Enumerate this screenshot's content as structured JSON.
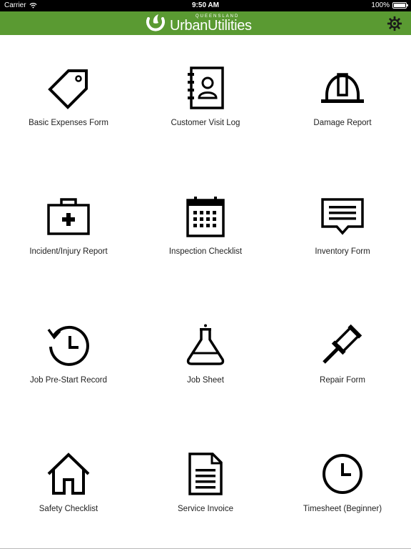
{
  "status_bar": {
    "carrier": "Carrier",
    "time": "9:50 AM",
    "battery": "100%"
  },
  "header": {
    "logo_small": "QUEENSLAND",
    "logo_word1": "Urban",
    "logo_word2": "Utilities",
    "brand_color": "#5a9a32",
    "settings_icon": "gear-icon"
  },
  "forms": [
    {
      "label": "Basic Expenses Form",
      "icon": "tag-icon"
    },
    {
      "label": "Customer Visit Log",
      "icon": "address-book-icon"
    },
    {
      "label": "Damage Report",
      "icon": "hard-hat-icon"
    },
    {
      "label": "Incident/Injury Report",
      "icon": "first-aid-kit-icon"
    },
    {
      "label": "Inspection Checklist",
      "icon": "calendar-icon"
    },
    {
      "label": "Inventory Form",
      "icon": "message-icon"
    },
    {
      "label": "Job Pre-Start Record",
      "icon": "history-icon"
    },
    {
      "label": "Job Sheet",
      "icon": "flask-icon"
    },
    {
      "label": "Repair Form",
      "icon": "gavel-icon"
    },
    {
      "label": "Safety Checklist",
      "icon": "house-icon"
    },
    {
      "label": "Service Invoice",
      "icon": "document-icon"
    },
    {
      "label": "Timesheet (Beginner)",
      "icon": "clock-icon"
    }
  ]
}
